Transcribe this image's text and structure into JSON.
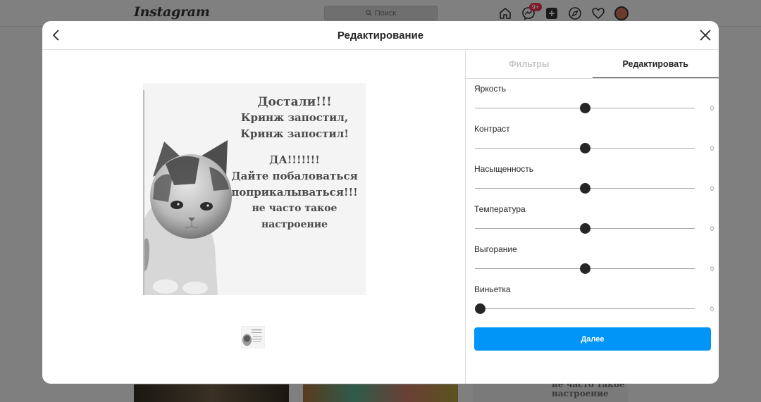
{
  "background": {
    "logo": "Instagram",
    "search_placeholder": "Поиск",
    "messages_badge": "9+",
    "thumb_text": [
      "не часто такое",
      "настроение"
    ]
  },
  "modal": {
    "title": "Редактирование",
    "tabs": [
      {
        "label": "Фильтры",
        "active": false
      },
      {
        "label": "Редактировать",
        "active": true
      }
    ],
    "adjustments": [
      {
        "label": "Яркость",
        "value": "0",
        "level": 0.5
      },
      {
        "label": "Контраст",
        "value": "0",
        "level": 0.5
      },
      {
        "label": "Насыщенность",
        "value": "0",
        "level": 0.5
      },
      {
        "label": "Температура",
        "value": "0",
        "level": 0.5
      },
      {
        "label": "Выгорание",
        "value": "0",
        "level": 0.5
      },
      {
        "label": "Виньетка",
        "value": "0",
        "level": 0.0
      }
    ],
    "next_label": "Далее"
  },
  "image": {
    "meme_lines": [
      "Достали!!!",
      "Кринж запостил,",
      "Кринж запостил!",
      "ДА!!!!!!!",
      "Дайте побаловаться",
      "поприкалываться!!!",
      "не часто такое",
      "настроение"
    ]
  },
  "colors": {
    "accent": "#0095f6",
    "overlay": "#7f7f7f"
  }
}
